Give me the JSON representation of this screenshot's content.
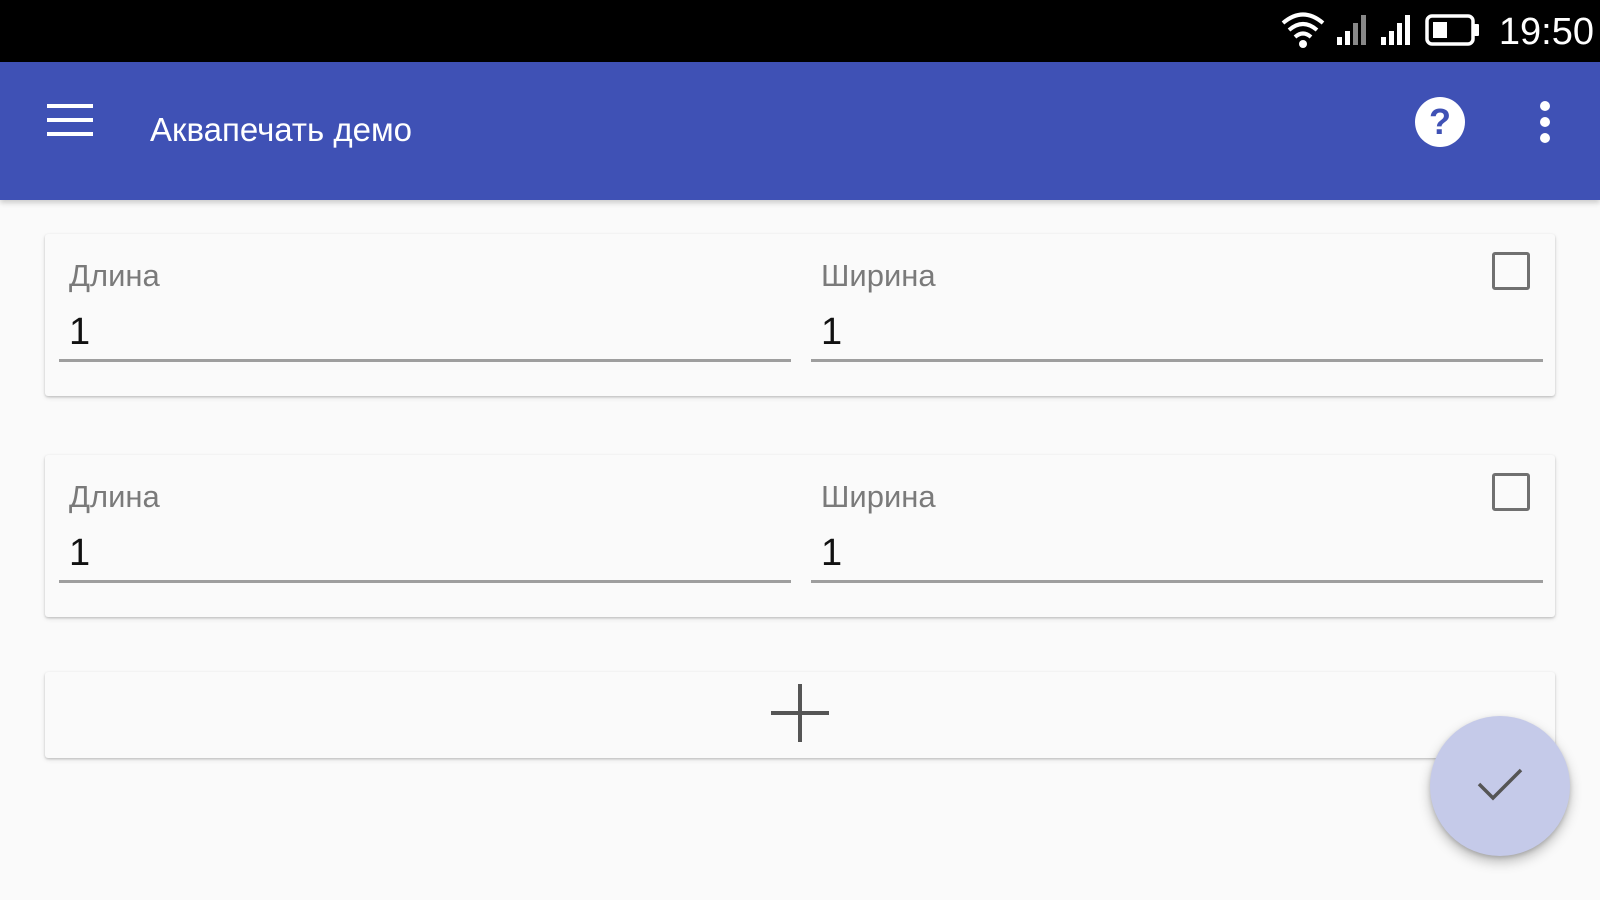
{
  "status_bar": {
    "time": "19:50",
    "icons": [
      "wifi-icon",
      "signal-icon",
      "signal-icon",
      "battery-icon"
    ]
  },
  "app_bar": {
    "title": "Аквапечать демо",
    "menu_icon": "menu-icon",
    "help_icon": "help-icon",
    "overflow_icon": "more-vert-icon",
    "color": "#3f51b5"
  },
  "items": [
    {
      "length_label": "Длина",
      "length_value": "1",
      "width_label": "Ширина",
      "width_value": "1",
      "checked": false
    },
    {
      "length_label": "Длина",
      "length_value": "1",
      "width_label": "Ширина",
      "width_value": "1",
      "checked": false
    }
  ],
  "add_button": {
    "icon": "plus-icon"
  },
  "fab": {
    "icon": "check-icon",
    "color": "#c5cae9"
  }
}
